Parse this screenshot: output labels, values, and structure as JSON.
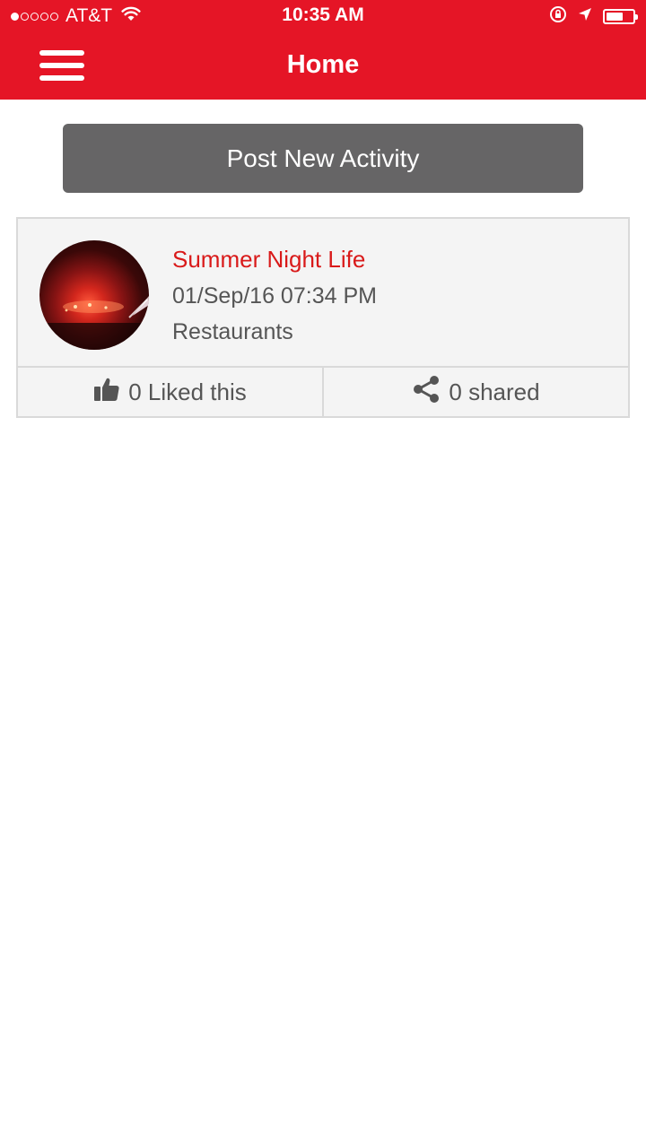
{
  "status_bar": {
    "carrier": "AT&T",
    "time": "10:35 AM",
    "signal_bars_filled": 1,
    "signal_bars_total": 5,
    "battery_level": 0.65
  },
  "nav": {
    "title": "Home",
    "menu_icon": "hamburger-menu-icon"
  },
  "actions": {
    "post_label": "Post New Activity"
  },
  "activities": [
    {
      "title": "Summer Night Life",
      "date": "01/Sep/16 07:34 PM",
      "category": "Restaurants",
      "likes_label": "0 Liked this",
      "shares_label": "0 shared",
      "like_icon": "thumbs-up-icon",
      "share_icon": "share-icon"
    }
  ],
  "colors": {
    "brand": "#e51526",
    "button": "#666566",
    "title_accent": "#d91a1a",
    "card_bg": "#f4f4f4",
    "card_border": "#d9d9d9",
    "text_muted": "#555555"
  }
}
